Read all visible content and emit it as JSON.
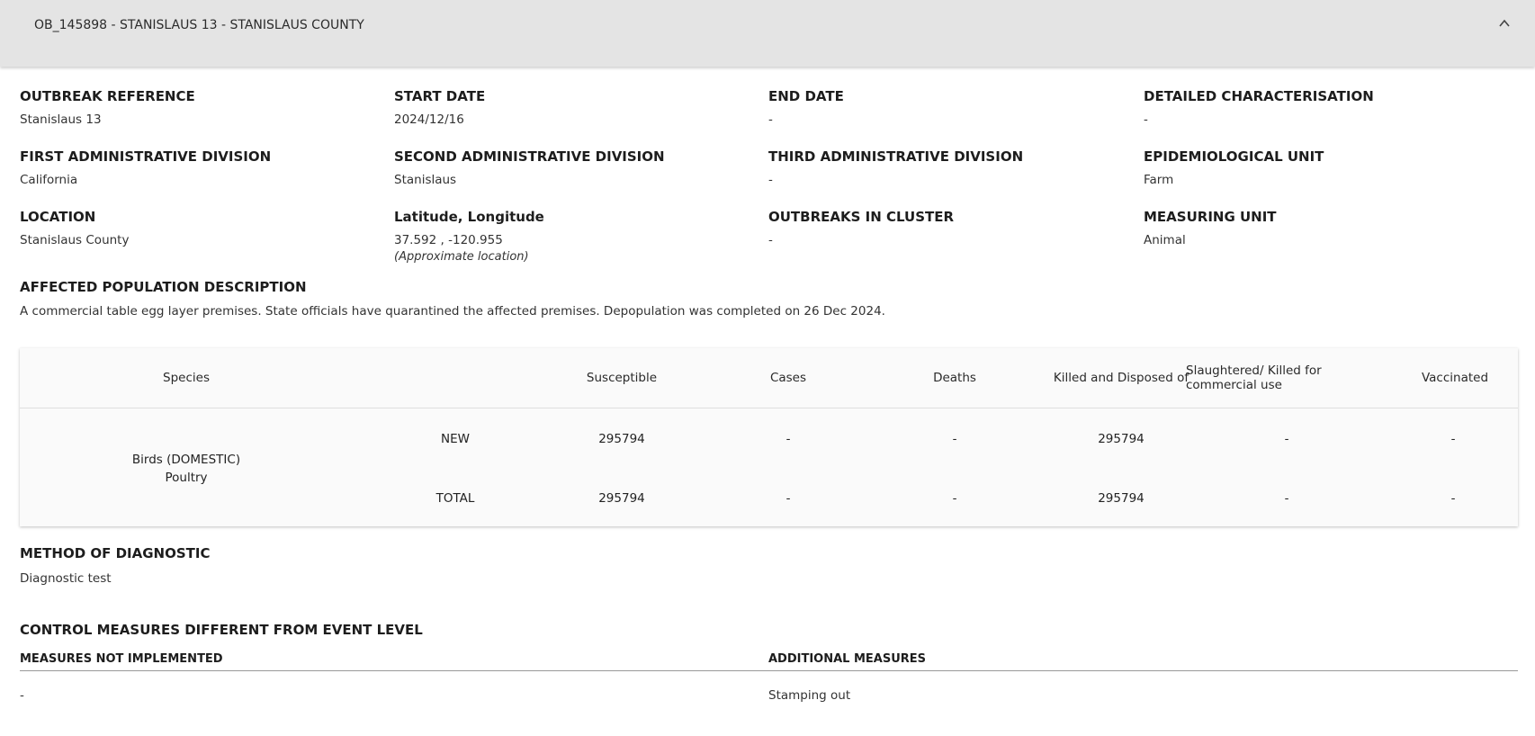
{
  "header": {
    "title": "OB_145898 - STANISLAUS 13 - STANISLAUS COUNTY"
  },
  "fields": {
    "outbreak_reference": {
      "label": "OUTBREAK REFERENCE",
      "value": "Stanislaus 13"
    },
    "start_date": {
      "label": "START DATE",
      "value": "2024/12/16"
    },
    "end_date": {
      "label": "END DATE",
      "value": "-"
    },
    "detailed_characterisation": {
      "label": "DETAILED CHARACTERISATION",
      "value": "-"
    },
    "first_admin": {
      "label": "FIRST ADMINISTRATIVE DIVISION",
      "value": "California"
    },
    "second_admin": {
      "label": "SECOND ADMINISTRATIVE DIVISION",
      "value": "Stanislaus"
    },
    "third_admin": {
      "label": "THIRD ADMINISTRATIVE DIVISION",
      "value": "-"
    },
    "epi_unit": {
      "label": "EPIDEMIOLOGICAL UNIT",
      "value": "Farm"
    },
    "location": {
      "label": "LOCATION",
      "value": "Stanislaus County"
    },
    "lat_long": {
      "label": "Latitude, Longitude",
      "value": "37.592 , -120.955",
      "note": "(Approximate location)"
    },
    "outbreaks_in_cluster": {
      "label": "OUTBREAKS IN CLUSTER",
      "value": "-"
    },
    "measuring_unit": {
      "label": "MEASURING UNIT",
      "value": "Animal"
    }
  },
  "affected_population": {
    "label": "AFFECTED POPULATION DESCRIPTION",
    "value": "A commercial table egg layer premises. State officials have quarantined the affected premises. Depopulation was completed on 26 Dec 2024."
  },
  "species_table": {
    "headers": {
      "species": "Species",
      "susceptible": "Susceptible",
      "cases": "Cases",
      "deaths": "Deaths",
      "killed": "Killed and Disposed of",
      "slaughtered": "Slaughtered/ Killed for commercial use",
      "vaccinated": "Vaccinated"
    },
    "species_line1": "Birds (DOMESTIC)",
    "species_line2": "Poultry",
    "rows": [
      {
        "type": "NEW",
        "susceptible": "295794",
        "cases": "-",
        "deaths": "-",
        "killed": "295794",
        "slaughtered": "-",
        "vaccinated": "-"
      },
      {
        "type": "TOTAL",
        "susceptible": "295794",
        "cases": "-",
        "deaths": "-",
        "killed": "295794",
        "slaughtered": "-",
        "vaccinated": "-"
      }
    ]
  },
  "diagnostic": {
    "label": "METHOD OF DIAGNOSTIC",
    "value": "Diagnostic test"
  },
  "control_measures": {
    "label": "CONTROL MEASURES DIFFERENT FROM EVENT LEVEL",
    "not_implemented_label": "MEASURES NOT IMPLEMENTED",
    "not_implemented_value": "-",
    "additional_label": "ADDITIONAL MEASURES",
    "additional_value": "Stamping out"
  },
  "icons": {
    "collapse": "chevron-up-icon"
  }
}
